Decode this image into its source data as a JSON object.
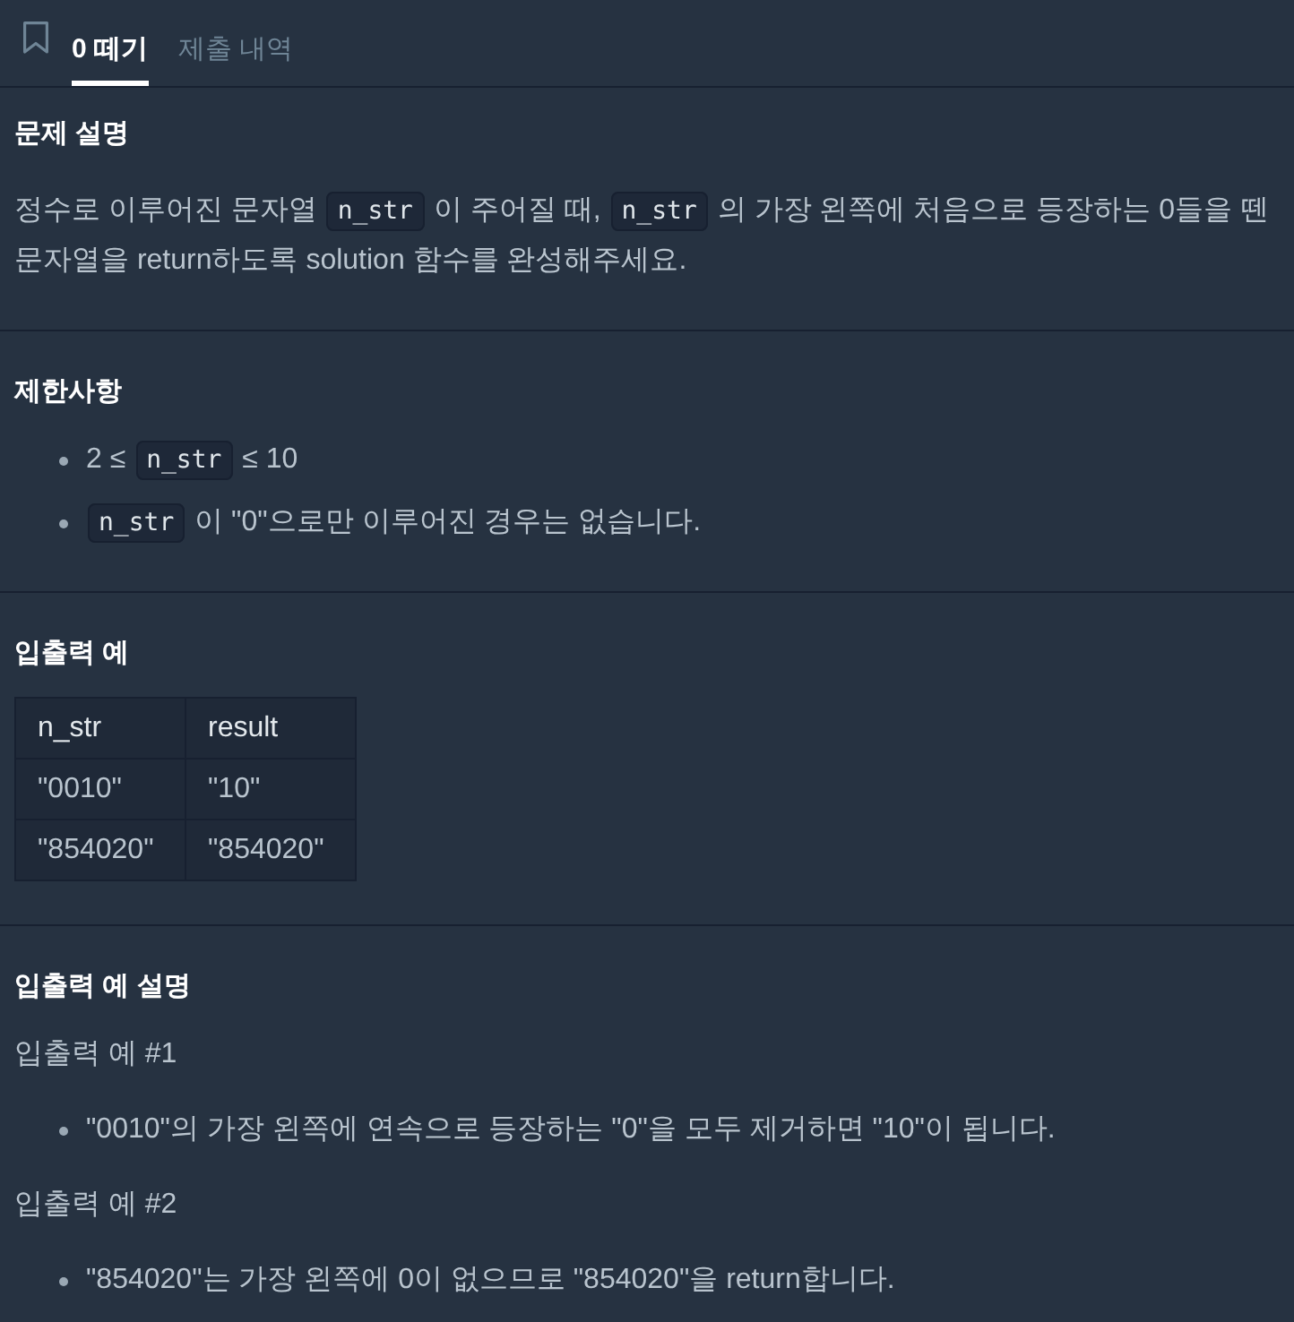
{
  "bookmark": {
    "bookmarked": false
  },
  "tabs": [
    {
      "label": "0 떼기",
      "selected": true
    },
    {
      "label": "제출 내역",
      "selected": false
    }
  ],
  "sections": [
    {
      "title": "문제 설명",
      "blocks": [
        {
          "kind": "paragraph",
          "segments": [
            {
              "kind": "text",
              "text": "정수로 이루어진 문자열 "
            },
            {
              "kind": "code",
              "text": "n_str"
            },
            {
              "kind": "text",
              "text": " 이 주어질 때, "
            },
            {
              "kind": "code",
              "text": "n_str"
            },
            {
              "kind": "text",
              "text": " 의 가장 왼쪽에 처음으로 등장하는 0들을 뗀 문자열을 return하도록 solution 함수를 완성해주세요."
            }
          ]
        }
      ]
    },
    {
      "title": "제한사항",
      "blocks": [
        {
          "kind": "bullets",
          "items": [
            [
              {
                "kind": "text",
                "text": "2 ≤ "
              },
              {
                "kind": "code",
                "text": "n_str"
              },
              {
                "kind": "text",
                "text": " ≤ 10"
              }
            ],
            [
              {
                "kind": "code",
                "text": "n_str"
              },
              {
                "kind": "text",
                "text": " 이 \"0\"으로만 이루어진 경우는 없습니다."
              }
            ]
          ]
        }
      ]
    },
    {
      "title": "입출력 예",
      "blocks": [
        {
          "kind": "table",
          "columns": [
            "n_str",
            "result"
          ],
          "rows": [
            [
              "\"0010\"",
              "\"10\""
            ],
            [
              "\"854020\"",
              "\"854020\""
            ]
          ]
        }
      ]
    },
    {
      "title": "입출력 예 설명",
      "blocks": [
        {
          "kind": "paragraph",
          "segments": [
            {
              "kind": "text",
              "text": "입출력 예 #1"
            }
          ]
        },
        {
          "kind": "bullets",
          "items": [
            [
              {
                "kind": "text",
                "text": "\"0010\"의 가장 왼쪽에 연속으로 등장하는 \"0\"을 모두 제거하면 \"10\"이 됩니다."
              }
            ]
          ]
        },
        {
          "kind": "paragraph",
          "segments": [
            {
              "kind": "text",
              "text": "입출력 예 #2"
            }
          ]
        },
        {
          "kind": "bullets",
          "items": [
            [
              {
                "kind": "text",
                "text": "\"854020\"는 가장 왼쪽에 0이 없으므로 \"854020\"을 return합니다."
              }
            ]
          ]
        }
      ]
    }
  ]
}
